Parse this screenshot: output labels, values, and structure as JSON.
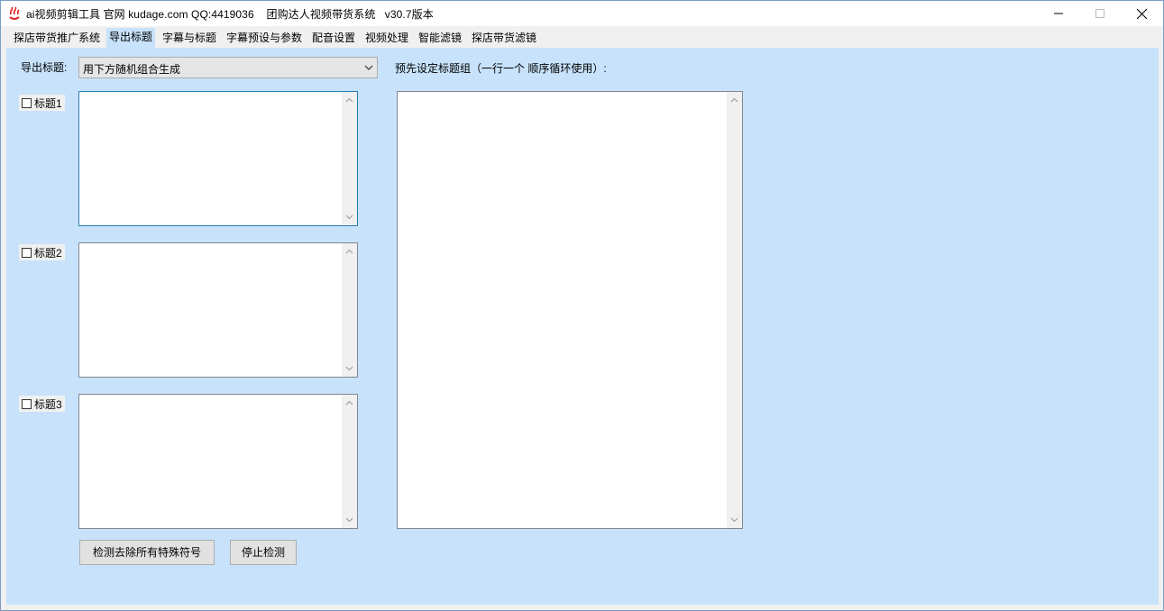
{
  "window": {
    "title": "ai视频剪辑工具 官网 kudage.com QQ:4419036    团购达人视频带货系统   v30.7版本"
  },
  "tabs": [
    {
      "label": "探店带货推广系统"
    },
    {
      "label": "导出标题",
      "active": true
    },
    {
      "label": "字幕与标题"
    },
    {
      "label": "字幕预设与参数"
    },
    {
      "label": "配音设置"
    },
    {
      "label": "视频处理"
    },
    {
      "label": "智能滤镜"
    },
    {
      "label": "探店带货滤镜"
    }
  ],
  "export": {
    "label": "导出标题:",
    "selected": "用下方随机组合生成"
  },
  "titles": [
    {
      "label": "标题1",
      "checked": false,
      "value": ""
    },
    {
      "label": "标题2",
      "checked": false,
      "value": ""
    },
    {
      "label": "标题3",
      "checked": false,
      "value": ""
    }
  ],
  "preset": {
    "label": "预先设定标题组（一行一个 顺序循环使用）:",
    "value": ""
  },
  "buttons": {
    "detect_label": "检测去除所有特殊符号",
    "stop_label": "停止检测"
  },
  "colors": {
    "panel_bg": "#c8e2fb",
    "app_icon": "#e02020"
  }
}
